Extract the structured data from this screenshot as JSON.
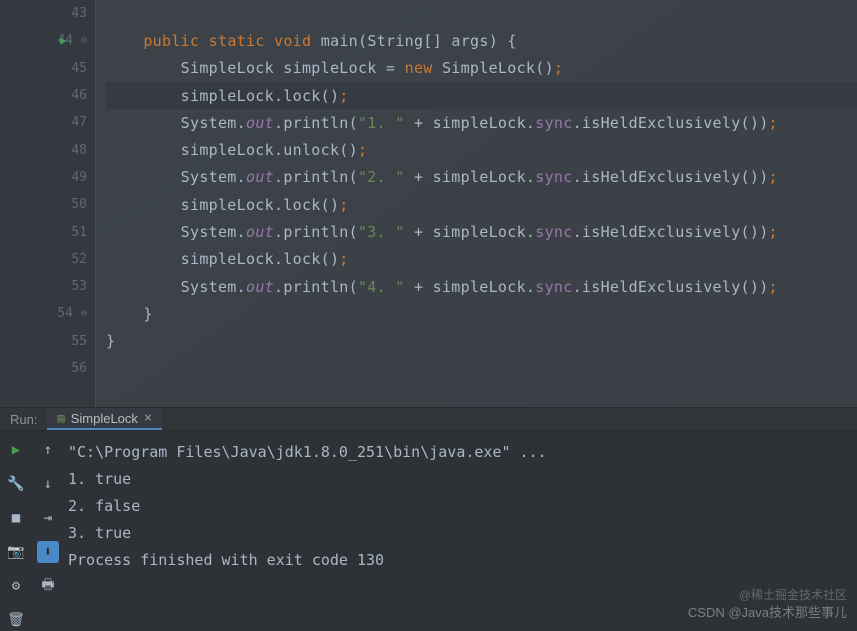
{
  "editor": {
    "lines": [
      {
        "num": "43",
        "indent": "",
        "tokens": []
      },
      {
        "num": "44",
        "indent": "    ",
        "play": true,
        "fold": "start",
        "tokens": [
          {
            "t": "public",
            "c": "kw"
          },
          {
            "t": " ",
            "c": ""
          },
          {
            "t": "static",
            "c": "kw"
          },
          {
            "t": " ",
            "c": ""
          },
          {
            "t": "void",
            "c": "kw"
          },
          {
            "t": " ",
            "c": ""
          },
          {
            "t": "main",
            "c": "method"
          },
          {
            "t": "(",
            "c": "paren"
          },
          {
            "t": "String",
            "c": "ident"
          },
          {
            "t": "[] ",
            "c": "paren"
          },
          {
            "t": "args",
            "c": "ident"
          },
          {
            "t": ")",
            "c": "paren"
          },
          {
            "t": " {",
            "c": "paren"
          }
        ]
      },
      {
        "num": "45",
        "indent": "        ",
        "tokens": [
          {
            "t": "SimpleLock simpleLock = ",
            "c": "ident"
          },
          {
            "t": "new",
            "c": "kw"
          },
          {
            "t": " SimpleLock()",
            "c": "ident"
          },
          {
            "t": ";",
            "c": "semi"
          }
        ]
      },
      {
        "num": "46",
        "indent": "        ",
        "hl": true,
        "tokens": [
          {
            "t": "simpleLock.lock()",
            "c": "ident"
          },
          {
            "t": ";",
            "c": "semi"
          }
        ]
      },
      {
        "num": "47",
        "indent": "        ",
        "tokens": [
          {
            "t": "System.",
            "c": "ident"
          },
          {
            "t": "out",
            "c": "static-field"
          },
          {
            "t": ".println(",
            "c": "ident"
          },
          {
            "t": "\"1. \"",
            "c": "str"
          },
          {
            "t": " + simpleLock.",
            "c": "ident"
          },
          {
            "t": "sync",
            "c": "field"
          },
          {
            "t": ".isHeldExclusively())",
            "c": "ident"
          },
          {
            "t": ";",
            "c": "semi"
          }
        ]
      },
      {
        "num": "48",
        "indent": "        ",
        "tokens": [
          {
            "t": "simpleLock.unlock()",
            "c": "ident"
          },
          {
            "t": ";",
            "c": "semi"
          }
        ]
      },
      {
        "num": "49",
        "indent": "        ",
        "tokens": [
          {
            "t": "System.",
            "c": "ident"
          },
          {
            "t": "out",
            "c": "static-field"
          },
          {
            "t": ".println(",
            "c": "ident"
          },
          {
            "t": "\"2. \"",
            "c": "str"
          },
          {
            "t": " + simpleLock.",
            "c": "ident"
          },
          {
            "t": "sync",
            "c": "field"
          },
          {
            "t": ".isHeldExclusively())",
            "c": "ident"
          },
          {
            "t": ";",
            "c": "semi"
          }
        ]
      },
      {
        "num": "50",
        "indent": "        ",
        "tokens": [
          {
            "t": "simpleLock.lock()",
            "c": "ident"
          },
          {
            "t": ";",
            "c": "semi"
          }
        ]
      },
      {
        "num": "51",
        "indent": "        ",
        "tokens": [
          {
            "t": "System.",
            "c": "ident"
          },
          {
            "t": "out",
            "c": "static-field"
          },
          {
            "t": ".println(",
            "c": "ident"
          },
          {
            "t": "\"3. \"",
            "c": "str"
          },
          {
            "t": " + simpleLock.",
            "c": "ident"
          },
          {
            "t": "sync",
            "c": "field"
          },
          {
            "t": ".isHeldExclusively())",
            "c": "ident"
          },
          {
            "t": ";",
            "c": "semi"
          }
        ]
      },
      {
        "num": "52",
        "indent": "        ",
        "tokens": [
          {
            "t": "simpleLock.lock()",
            "c": "ident"
          },
          {
            "t": ";",
            "c": "semi"
          }
        ]
      },
      {
        "num": "53",
        "indent": "        ",
        "tokens": [
          {
            "t": "System.",
            "c": "ident"
          },
          {
            "t": "out",
            "c": "static-field"
          },
          {
            "t": ".println(",
            "c": "ident"
          },
          {
            "t": "\"4. \"",
            "c": "str"
          },
          {
            "t": " + simpleLock.",
            "c": "ident"
          },
          {
            "t": "sync",
            "c": "field"
          },
          {
            "t": ".isHeldExclusively())",
            "c": "ident"
          },
          {
            "t": ";",
            "c": "semi"
          }
        ]
      },
      {
        "num": "54",
        "indent": "    ",
        "fold": "end",
        "tokens": [
          {
            "t": "}",
            "c": "paren"
          }
        ]
      },
      {
        "num": "55",
        "indent": "",
        "tokens": [
          {
            "t": "}",
            "c": "paren"
          }
        ]
      },
      {
        "num": "56",
        "indent": "",
        "tokens": []
      }
    ]
  },
  "run": {
    "label": "Run:",
    "tab_name": "SimpleLock",
    "console_lines": [
      "\"C:\\Program Files\\Java\\jdk1.8.0_251\\bin\\java.exe\" ...",
      "1. true",
      "2. false",
      "3. true",
      "",
      "Process finished with exit code 130"
    ]
  },
  "watermark1": "@稀土掘金技术社区",
  "watermark2": "CSDN @Java技术那些事儿"
}
